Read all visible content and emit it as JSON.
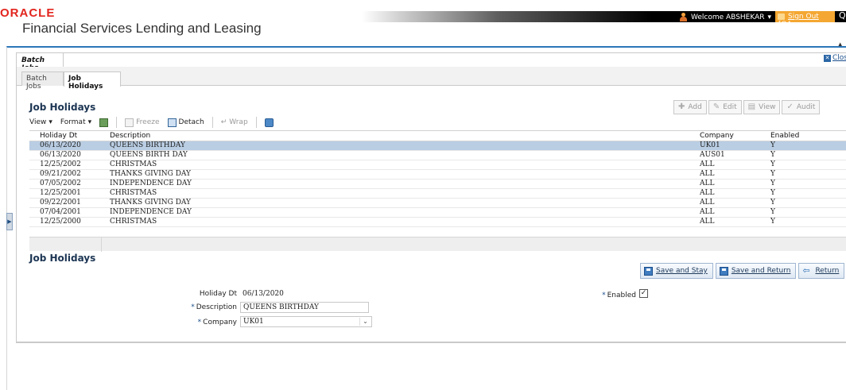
{
  "header": {
    "logo": "ORACLE",
    "product": "Financial Services Lending and Leasing",
    "welcome": "Welcome ABSHEKAR",
    "signout": "Sign Out [QA"
  },
  "window": {
    "tab": "Batch Jobs",
    "close": "Clos"
  },
  "tabs": [
    "Batch Jobs",
    "Job Holidays"
  ],
  "list": {
    "title": "Job Holidays",
    "actions": [
      "Add",
      "Edit",
      "View",
      "Audit"
    ],
    "toolbar": {
      "view": "View",
      "format": "Format",
      "freeze": "Freeze",
      "detach": "Detach",
      "wrap": "Wrap"
    },
    "columns": [
      "Holiday Dt",
      "Description",
      "Company",
      "Enabled"
    ],
    "rows": [
      {
        "date": "06/13/2020",
        "desc": "QUEENS BIRTHDAY",
        "company": "UK01",
        "enabled": "Y"
      },
      {
        "date": "06/13/2020",
        "desc": "QUEENS BIRTH DAY",
        "company": "AUS01",
        "enabled": "Y"
      },
      {
        "date": "12/25/2002",
        "desc": "CHRISTMAS",
        "company": "ALL",
        "enabled": "Y"
      },
      {
        "date": "09/21/2002",
        "desc": "THANKS GIVING DAY",
        "company": "ALL",
        "enabled": "Y"
      },
      {
        "date": "07/05/2002",
        "desc": "INDEPENDENCE DAY",
        "company": "ALL",
        "enabled": "Y"
      },
      {
        "date": "12/25/2001",
        "desc": "CHRISTMAS",
        "company": "ALL",
        "enabled": "Y"
      },
      {
        "date": "09/22/2001",
        "desc": "THANKS GIVING DAY",
        "company": "ALL",
        "enabled": "Y"
      },
      {
        "date": "07/04/2001",
        "desc": "INDEPENDENCE DAY",
        "company": "ALL",
        "enabled": "Y"
      },
      {
        "date": "12/25/2000",
        "desc": "CHRISTMAS",
        "company": "ALL",
        "enabled": "Y"
      }
    ]
  },
  "form": {
    "title": "Job Holidays",
    "buttons": {
      "save_stay": "Save and Stay",
      "save_return": "Save and Return",
      "return": "Return"
    },
    "holiday_dt_label": "Holiday Dt",
    "holiday_dt_value": "06/13/2020",
    "description_label": "Description",
    "description_value": "QUEENS BIRTHDAY",
    "company_label": "Company",
    "company_value": "UK01",
    "enabled_label": "Enabled",
    "required_mark": "*"
  }
}
